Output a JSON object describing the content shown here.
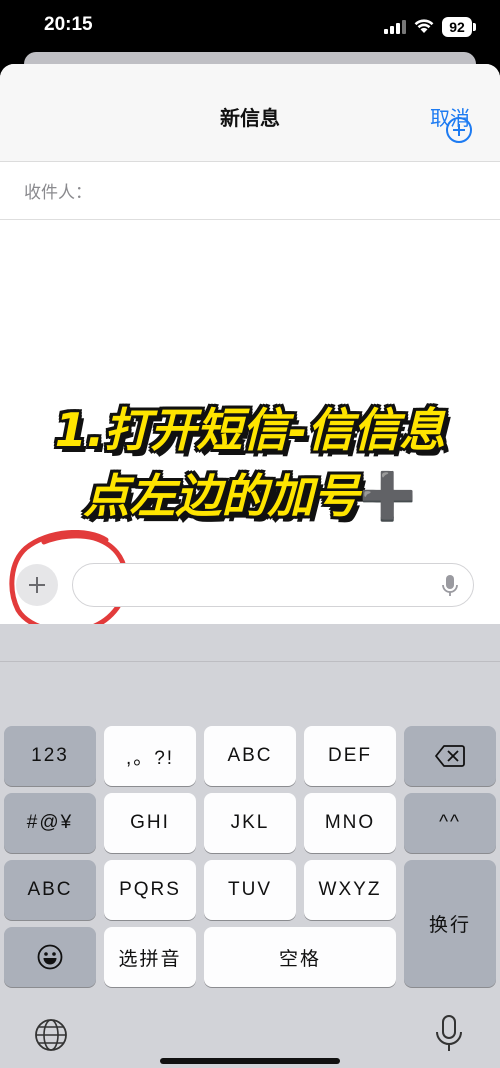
{
  "status_bar": {
    "time": "20:15",
    "battery": "92"
  },
  "nav": {
    "title": "新信息",
    "cancel": "取消"
  },
  "recipient": {
    "label": "收件人："
  },
  "caption": {
    "line1": "1.打开短信-信信息",
    "line2": "点左边的加号",
    "plus": "➕"
  },
  "colors": {
    "accent": "#1d7bf2",
    "caption": "#ffe500",
    "highlight_circle": "#e23b3b"
  },
  "icons": [
    "signal-icon",
    "wifi-icon",
    "battery-icon",
    "add-contact-icon",
    "plus-icon",
    "mic-icon",
    "delete-icon",
    "emoji-icon",
    "globe-icon"
  ],
  "keyboard": {
    "row1": {
      "k1": "123",
      "k2": ",。?!",
      "k3": "ABC",
      "k4": "DEF"
    },
    "row2": {
      "k1": "#@¥",
      "k2": "GHI",
      "k3": "JKL",
      "k4": "MNO",
      "k5": "^^"
    },
    "row3": {
      "k1": "ABC",
      "k2": "PQRS",
      "k3": "TUV",
      "k4": "WXYZ",
      "return": "换行"
    },
    "row4": {
      "pinyin": "选拼音",
      "space": "空格"
    }
  }
}
